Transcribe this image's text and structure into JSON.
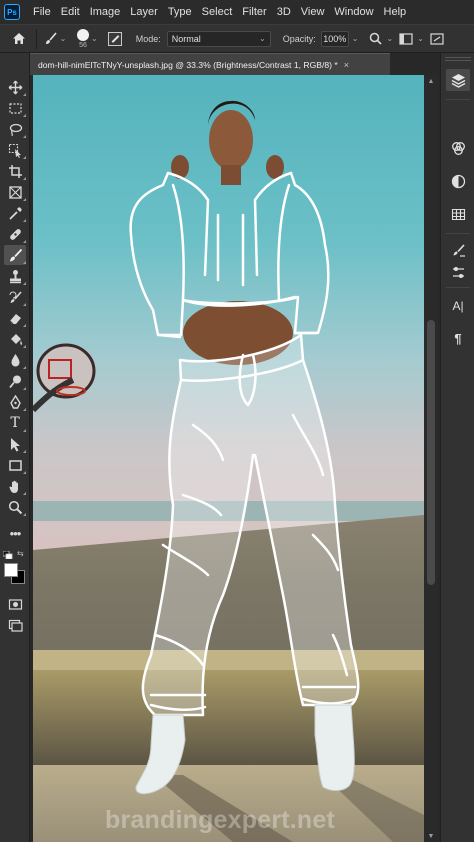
{
  "app": {
    "logo_text": "Ps"
  },
  "menu": [
    "File",
    "Edit",
    "Image",
    "Layer",
    "Type",
    "Select",
    "Filter",
    "3D",
    "View",
    "Window",
    "Help"
  ],
  "options": {
    "brush_size": "56",
    "mode_label": "Mode:",
    "mode_value": "Normal",
    "opacity_label": "Opacity:",
    "opacity_value": "100%"
  },
  "document": {
    "tab_title": "dom-hill-nimElTcTNyY-unsplash.jpg @ 33.3% (Brightness/Contrast 1, RGB/8) *",
    "close_glyph": "×"
  },
  "colors": {
    "foreground": "#ffffff",
    "background": "#000000",
    "accent": "#31a8ff"
  },
  "tools": [
    {
      "icon": "move-icon",
      "active": false
    },
    {
      "icon": "marquee-icon",
      "active": false
    },
    {
      "icon": "lasso-icon",
      "active": false
    },
    {
      "icon": "object-selection-icon",
      "active": false
    },
    {
      "icon": "crop-icon",
      "active": false
    },
    {
      "icon": "frame-icon",
      "active": false
    },
    {
      "icon": "eyedropper-icon",
      "active": false
    },
    {
      "icon": "healing-brush-icon",
      "active": false
    },
    {
      "icon": "brush-icon",
      "active": true
    },
    {
      "icon": "clone-stamp-icon",
      "active": false
    },
    {
      "icon": "history-brush-icon",
      "active": false
    },
    {
      "icon": "eraser-icon",
      "active": false
    },
    {
      "icon": "paint-bucket-icon",
      "active": false
    },
    {
      "icon": "blur-icon",
      "active": false
    },
    {
      "icon": "dodge-icon",
      "active": false
    },
    {
      "icon": "pen-icon",
      "active": false
    },
    {
      "icon": "type-icon",
      "active": false
    },
    {
      "icon": "path-selection-icon",
      "active": false
    },
    {
      "icon": "rectangle-icon",
      "active": false
    },
    {
      "icon": "hand-icon",
      "active": false
    },
    {
      "icon": "zoom-icon",
      "active": false
    },
    {
      "icon": "more-tools-icon",
      "active": false
    }
  ],
  "panels": [
    {
      "icon": "layers-icon",
      "active": true
    },
    {
      "icon": "channels-icon",
      "active": false
    },
    {
      "icon": "adjustments-icon",
      "active": false
    },
    {
      "icon": "swatches-grid-icon",
      "active": false
    },
    {
      "icon": "brushes-icon",
      "active": false
    },
    {
      "icon": "brush-settings-icon",
      "active": false
    },
    {
      "icon": "character-icon",
      "active": false
    },
    {
      "icon": "paragraph-icon",
      "active": false
    }
  ],
  "type_glyph": "T",
  "character_glyph": "A|",
  "paragraph_glyph": "¶",
  "watermark": "brandingexpert.net"
}
